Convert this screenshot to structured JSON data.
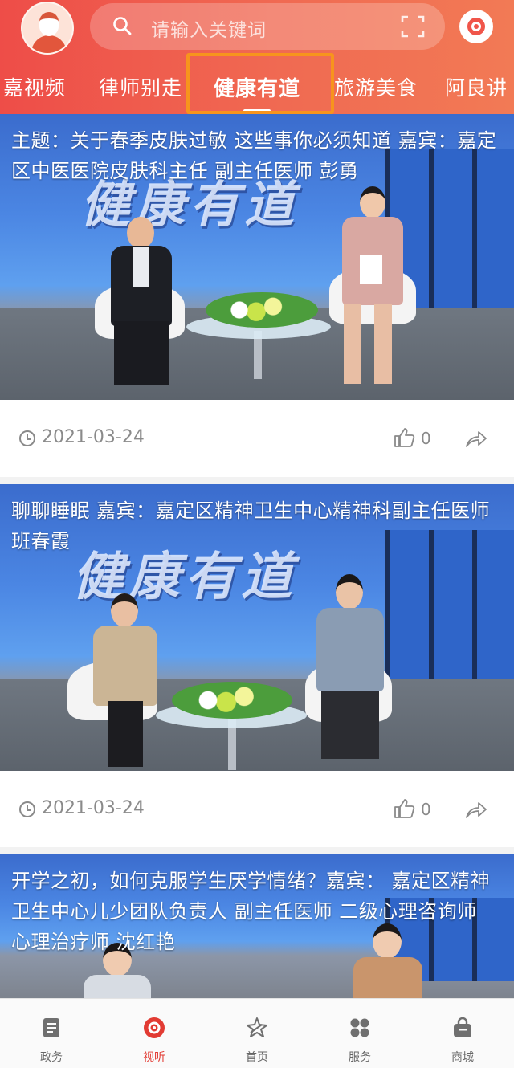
{
  "header": {
    "search_placeholder": "请输入关键词",
    "tabs": [
      {
        "label": "嘉视频",
        "active": false
      },
      {
        "label": "律师别走",
        "active": false
      },
      {
        "label": "健康有道",
        "active": true
      },
      {
        "label": "旅游美食",
        "active": false
      },
      {
        "label": "阿良讲",
        "active": false
      }
    ]
  },
  "feed": [
    {
      "title": "主题：关于春季皮肤过敏 这些事你必须知道 嘉宾：嘉定区中医医院皮肤科主任 副主任医师 彭勇",
      "thumbnail_caption": "健康有道",
      "date": "2021-03-24",
      "likes": "0"
    },
    {
      "title": "聊聊睡眠 嘉宾：嘉定区精神卫生中心精神科副主任医师班春霞",
      "thumbnail_caption": "健康有道",
      "date": "2021-03-24",
      "likes": "0"
    },
    {
      "title": "开学之初，如何克服学生厌学情绪？嘉宾： 嘉定区精神卫生中心儿少团队负责人 副主任医师 二级心理咨询师 心理治疗师 沈红艳"
    }
  ],
  "bottom_nav": [
    {
      "label": "政务",
      "icon": "document-icon",
      "active": false
    },
    {
      "label": "视听",
      "icon": "record-icon",
      "active": true
    },
    {
      "label": "首页",
      "icon": "star-logo-icon",
      "active": false
    },
    {
      "label": "服务",
      "icon": "grid-icon",
      "active": false
    },
    {
      "label": "商城",
      "icon": "bag-icon",
      "active": false
    }
  ],
  "colors": {
    "header_start": "#ee4d48",
    "header_end": "#f27a55",
    "highlight_box": "#f7941d",
    "active_nav": "#e23b33"
  }
}
